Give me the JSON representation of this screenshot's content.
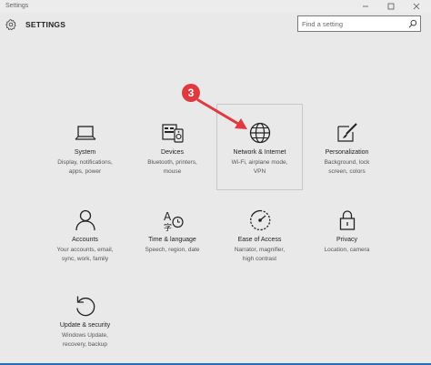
{
  "window": {
    "title": "Settings",
    "minimize_icon": "minimize-icon",
    "maximize_icon": "maximize-icon",
    "close_icon": "close-icon"
  },
  "header": {
    "icon": "gear-icon",
    "title": "SETTINGS"
  },
  "search": {
    "placeholder": "Find a setting",
    "value": "",
    "icon": "search-icon"
  },
  "tiles": [
    {
      "title": "System",
      "description": [
        "Display, notifications,",
        "apps, power"
      ],
      "icon": "laptop-icon"
    },
    {
      "title": "Devices",
      "description": [
        "Bluetooth, printers,",
        "mouse"
      ],
      "icon": "devices-icon"
    },
    {
      "title": "Network & Internet",
      "description": [
        "Wi-Fi, airplane mode,",
        "VPN"
      ],
      "icon": "globe-icon",
      "selected": true
    },
    {
      "title": "Personalization",
      "description": [
        "Background, lock",
        "screen, colors"
      ],
      "icon": "paint-brush-icon"
    },
    {
      "title": "Accounts",
      "description": [
        "Your accounts, email,",
        "sync, work, family"
      ],
      "icon": "person-icon"
    },
    {
      "title": "Time & language",
      "description": [
        "Speech, region, date"
      ],
      "icon": "time-language-icon"
    },
    {
      "title": "Ease of Access",
      "description": [
        "Narrator, magnifier,",
        "high contrast"
      ],
      "icon": "ease-of-access-icon"
    },
    {
      "title": "Privacy",
      "description": [
        "Location, camera"
      ],
      "icon": "lock-icon"
    },
    {
      "title": "Update & security",
      "description": [
        "Windows Update,",
        "recovery, backup"
      ],
      "icon": "refresh-icon"
    }
  ],
  "annotation": {
    "badge": "3",
    "color": "#e0393e"
  },
  "colors": {
    "background": "#e9e9e9",
    "accent": "#1f6fc3"
  }
}
